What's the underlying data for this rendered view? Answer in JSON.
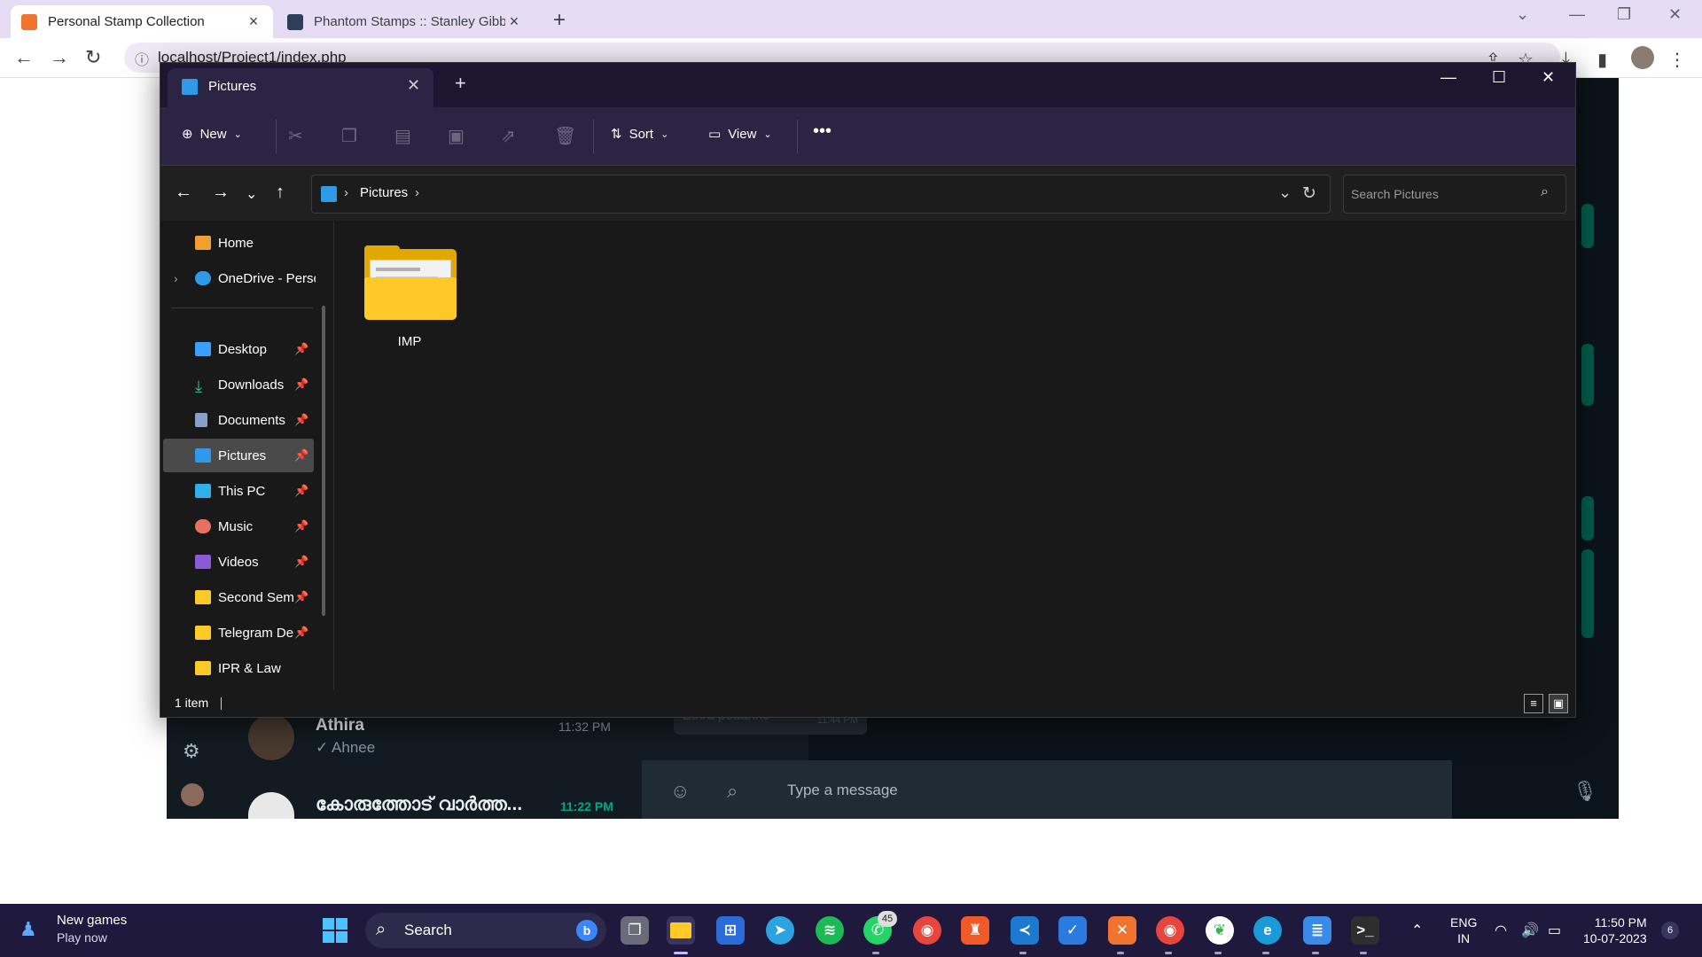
{
  "browser": {
    "tabs": [
      {
        "title": "Personal Stamp Collection",
        "active": true,
        "favicon": "xampp-icon"
      },
      {
        "title": "Phantom Stamps :: Stanley Gibbo",
        "active": false,
        "favicon": "sg-icon"
      }
    ],
    "url": "localhost/Project1/index.php"
  },
  "whatsapp": {
    "chats": [
      {
        "name": "Athira",
        "preview": "✓ Ahnee",
        "time": "11:32 PM"
      },
      {
        "name": "കോരുത്തോട് വാർത്ത...",
        "preview": "",
        "time": "11:22 PM"
      }
    ],
    "bubble_text": "Ethra pettanno",
    "bubble_time": "11:44 PM",
    "placeholder": "Type a message"
  },
  "explorer": {
    "tab_title": "Pictures",
    "commands": {
      "new": "New",
      "sort": "Sort",
      "view": "View"
    },
    "breadcrumb": [
      "Pictures"
    ],
    "search_placeholder": "Search Pictures",
    "nav": [
      {
        "label": "Home",
        "icon": "home-icon",
        "color": "#f0a030"
      },
      {
        "label": "OneDrive - Perso",
        "icon": "cloud-icon",
        "color": "#2f9be8"
      },
      {
        "label": "Desktop",
        "icon": "desktop-icon",
        "color": "#3aa0ff"
      },
      {
        "label": "Downloads",
        "icon": "download-icon",
        "color": "#3ac0a0"
      },
      {
        "label": "Documents",
        "icon": "document-icon",
        "color": "#8aa0c8"
      },
      {
        "label": "Pictures",
        "icon": "pictures-icon",
        "color": "#2f9be8",
        "selected": true
      },
      {
        "label": "This PC",
        "icon": "pc-icon",
        "color": "#2fb0e8"
      },
      {
        "label": "Music",
        "icon": "music-icon",
        "color": "#e87060"
      },
      {
        "label": "Videos",
        "icon": "videos-icon",
        "color": "#8a5ad8"
      },
      {
        "label": "Second Seme",
        "icon": "folder-icon",
        "color": "#ffc928"
      },
      {
        "label": "Telegram De",
        "icon": "folder-icon",
        "color": "#ffc928"
      },
      {
        "label": "IPR & Law",
        "icon": "folder-icon",
        "color": "#ffc928"
      }
    ],
    "items": [
      {
        "name": "IMP",
        "type": "folder"
      }
    ],
    "status": "1 item"
  },
  "taskbar": {
    "weather_title": "New games",
    "weather_sub": "Play now",
    "search_label": "Search",
    "whatsapp_badge": "45",
    "lang": "ENG",
    "region": "IN",
    "time": "11:50 PM",
    "date": "10-07-2023",
    "notifications": "6"
  }
}
